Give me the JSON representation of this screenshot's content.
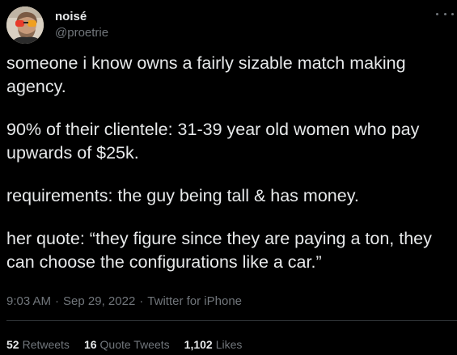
{
  "author": {
    "display_name": "noisé",
    "handle": "@proetrie"
  },
  "tweet": {
    "paragraphs": [
      "someone i know owns a fairly sizable match making agency.",
      "90% of their clientele: 31-39 year old women who pay upwards of $25k.",
      "requirements: the guy being tall & has money.",
      "her quote: “they figure since they are paying a ton, they can choose the configurations like a car.”"
    ],
    "time": "9:03 AM",
    "date": "Sep 29, 2022",
    "source": "Twitter for iPhone",
    "separator": "·"
  },
  "stats": {
    "retweets_count": "52",
    "retweets_label": "Retweets",
    "quotes_count": "16",
    "quotes_label": "Quote Tweets",
    "likes_count": "1,102",
    "likes_label": "Likes"
  },
  "icons": {
    "avatar": "avatar-image",
    "more": "more-options-icon"
  },
  "colors": {
    "background": "#000000",
    "text": "#e7e9ea",
    "secondary": "#71767b",
    "divider": "#2f3336"
  }
}
